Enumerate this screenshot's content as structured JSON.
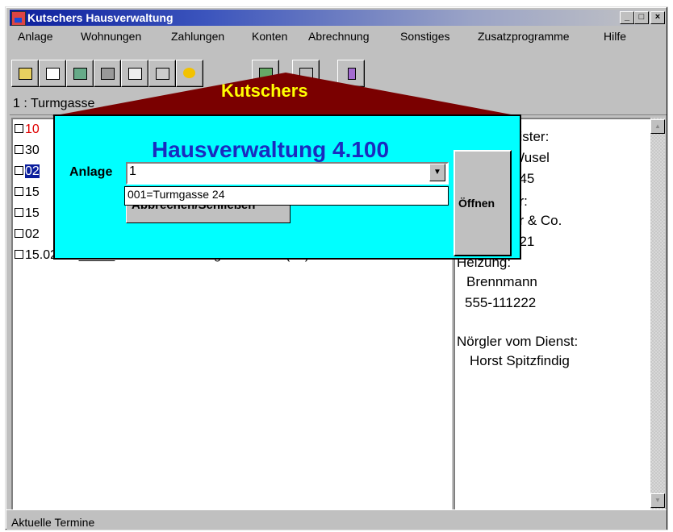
{
  "window": {
    "title": "Kutschers Hausverwaltung",
    "minimize": "_",
    "maximize": "□",
    "close": "×"
  },
  "menu": [
    "Anlage",
    "Wohnungen",
    "Zahlungen",
    "Konten",
    "Abrechnung",
    "Sonstiges",
    "Zusatzprogramme",
    "Hilfe"
  ],
  "address_bar": "1 : Turmgasse",
  "tasks": [
    {
      "date": "10",
      "color": "#e00000"
    },
    {
      "date": "30",
      "color": "#000000"
    },
    {
      "date": "02",
      "color": "#000000",
      "selected": true
    },
    {
      "date": "15",
      "color": "#000000"
    },
    {
      "date": "15",
      "color": "#000000"
    },
    {
      "date": "02",
      "color": "#000000"
    },
    {
      "date": "15.02.02 _____ Probeabrechnung erstellen  * ( -1)",
      "color": "#000000"
    }
  ],
  "contacts": {
    "hausmeister_label": "eister:",
    "hausmeister_name": "Wusel",
    "hausmeister_phone": "345",
    "second_label": "er:",
    "second_name": "hr & Co.",
    "second_phone": "221",
    "heizung_label": "Heizung:",
    "heizung_name": "Brennmann",
    "heizung_phone": "555-111222",
    "noergler_label": "Nörgler vom Dienst:",
    "noergler_name": "Horst Spitzfindig"
  },
  "status": "Aktuelle Termine",
  "splash": {
    "brand": "Kutschers",
    "title": "Hausverwaltung 4.100",
    "anlage_label": "Anlage",
    "anlage_value": "1",
    "dropdown_option": "001=Turmgasse 24",
    "hidden_button": "Abbrechen/Schließen",
    "open_button": "Öffnen"
  },
  "colors": {
    "accent_title": "#0b1e9c",
    "splash_bg": "#00ffff",
    "roof": "#7a0000",
    "brand_text": "#ffff00",
    "splash_title": "#1a2bbf"
  }
}
